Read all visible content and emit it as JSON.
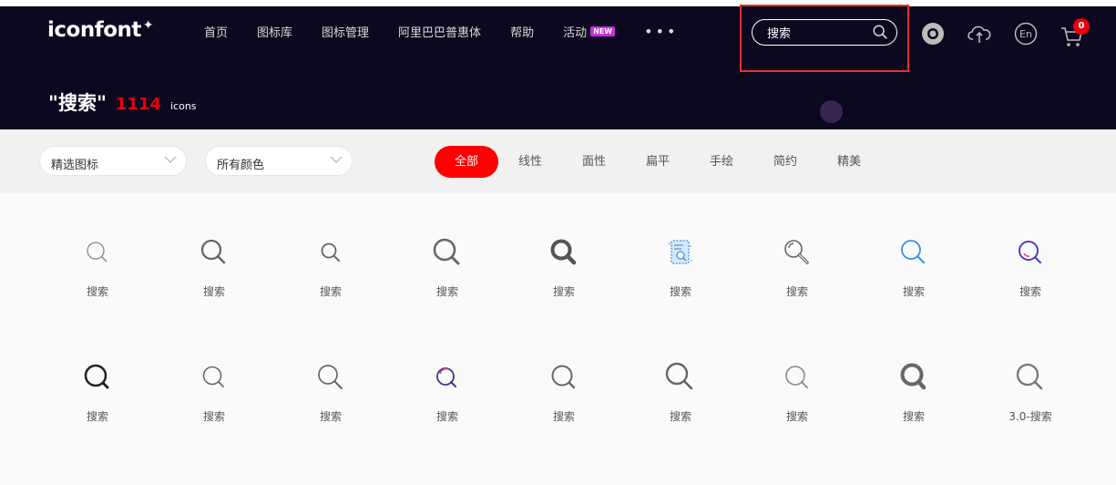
{
  "header": {
    "logo": "iconfont",
    "logo_plus": "✦",
    "nav": [
      "首页",
      "图标库",
      "图标管理",
      "阿里巴巴普惠体",
      "帮助",
      "活动"
    ],
    "new_badge": "NEW",
    "more": "•••",
    "search": {
      "value": "搜索",
      "icon": "search-icon"
    },
    "icons": [
      "user-avatar-icon",
      "upload-cloud-icon",
      "language-en-icon",
      "cart-icon"
    ],
    "lang_label": "En",
    "cart_count": "0"
  },
  "result": {
    "query": "\"搜索\"",
    "count": "1114",
    "unit": "icons"
  },
  "filters": {
    "select1": "精选图标",
    "select2": "所有颜色",
    "tabs": [
      "全部",
      "线性",
      "面性",
      "扁平",
      "手绘",
      "简约",
      "精美"
    ],
    "active_tab": "全部"
  },
  "colors": {
    "header_bg": "#0c0820",
    "accent": "#ff0000",
    "highlight": "#e8312e"
  },
  "icons_grid": {
    "row1": [
      "搜索",
      "搜索",
      "搜索",
      "搜索",
      "搜索",
      "搜索",
      "搜索",
      "搜索",
      "搜索"
    ],
    "row2": [
      "搜索",
      "搜索",
      "搜索",
      "搜索",
      "搜索",
      "搜索",
      "搜索",
      "搜索",
      "3.0-搜索"
    ]
  }
}
